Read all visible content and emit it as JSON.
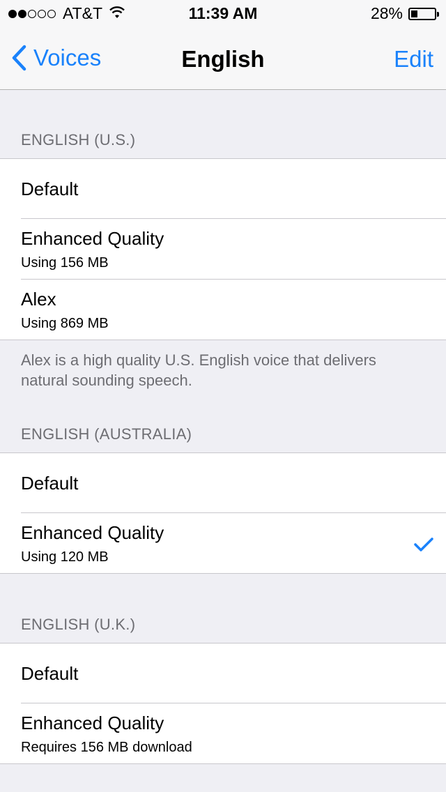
{
  "status_bar": {
    "signal_dots_filled": 2,
    "signal_dots_total": 5,
    "carrier": "AT&T",
    "time": "11:39 AM",
    "battery": "28%",
    "battery_level": 0.28
  },
  "nav": {
    "back_label": "Voices",
    "title": "English",
    "edit_label": "Edit"
  },
  "sections": [
    {
      "header": "ENGLISH (U.S.)",
      "rows": [
        {
          "title": "Default"
        },
        {
          "title": "Enhanced Quality",
          "subtitle": "Using 156 MB"
        },
        {
          "title": "Alex",
          "subtitle": "Using 869 MB"
        }
      ],
      "footer": "Alex is a high quality U.S. English voice that delivers natural sounding speech."
    },
    {
      "header": "ENGLISH (AUSTRALIA)",
      "rows": [
        {
          "title": "Default"
        },
        {
          "title": "Enhanced Quality",
          "subtitle": "Using 120 MB",
          "selected": true
        }
      ]
    },
    {
      "header": "ENGLISH (U.K.)",
      "rows": [
        {
          "title": "Default"
        },
        {
          "title": "Enhanced Quality",
          "subtitle": "Requires 156 MB download"
        }
      ]
    }
  ],
  "colors": {
    "accent": "#1a82fb",
    "background": "#efeff4",
    "header_text": "#6d6d72"
  }
}
